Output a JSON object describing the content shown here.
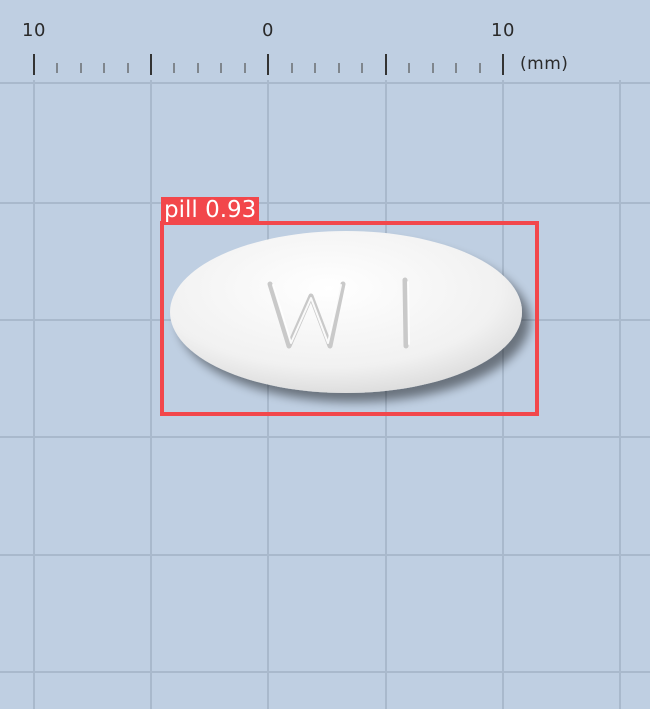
{
  "ruler": {
    "label_left": "10",
    "label_center": "0",
    "label_right": "10",
    "unit": "(mm)"
  },
  "pill": {
    "imprint": "W1",
    "color": "#f4f4f4"
  },
  "detection": {
    "label": "pill 0.93",
    "color": "#f2474b"
  },
  "colors": {
    "background": "#bfcfe2",
    "gridline": "#a9b9cc"
  }
}
